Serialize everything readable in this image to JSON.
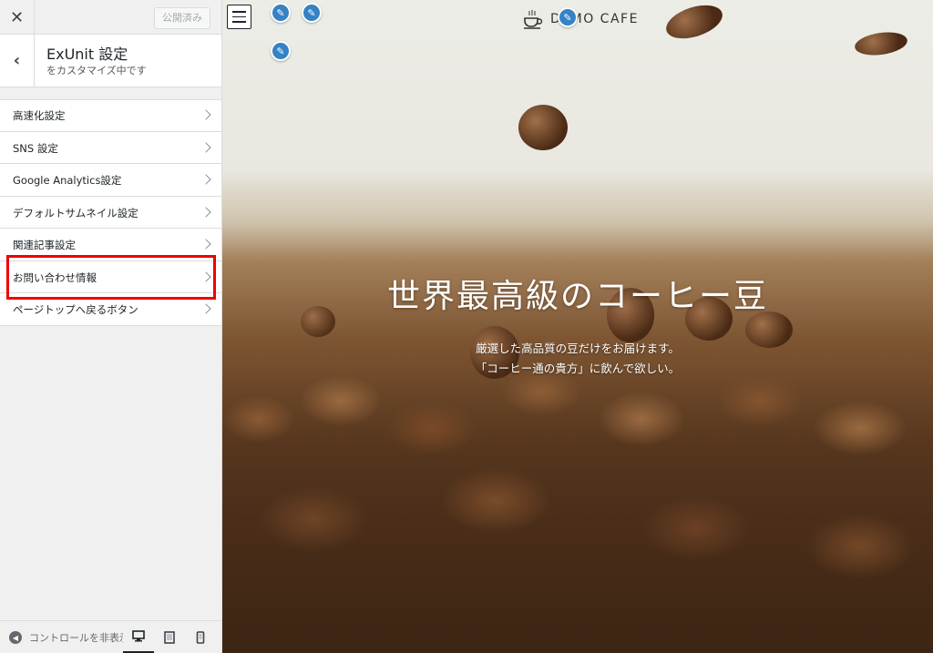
{
  "topbar": {
    "close_label": "✕",
    "publish_label": "公開済み"
  },
  "section": {
    "back_label": "‹",
    "title": "ExUnit 設定",
    "subtitle": "をカスタマイズ中です"
  },
  "menu": {
    "items": [
      {
        "label": "高速化設定"
      },
      {
        "label": "SNS 設定"
      },
      {
        "label": "Google Analytics設定"
      },
      {
        "label": "デフォルトサムネイル設定"
      },
      {
        "label": "関連記事設定"
      },
      {
        "label": "お問い合わせ情報"
      },
      {
        "label": "ページトップへ戻るボタン"
      }
    ],
    "highlighted_index": 5
  },
  "footer": {
    "collapse_label": "コントロールを非表示",
    "devices": [
      "desktop-icon",
      "tablet-icon",
      "mobile-icon"
    ],
    "active_device": "desktop"
  },
  "preview": {
    "logo_text": "DEMO CAFE",
    "hero_title": "世界最高級のコーヒー豆",
    "hero_line1": "厳選した高品質の豆だけをお届けます。",
    "hero_line2": "「コーヒー通の貴方」に飲んで欲しい。"
  },
  "colors": {
    "highlight_border": "#ee0000",
    "pencil_blue": "#3582c4",
    "sidebar_bg": "#f0f0f1"
  }
}
